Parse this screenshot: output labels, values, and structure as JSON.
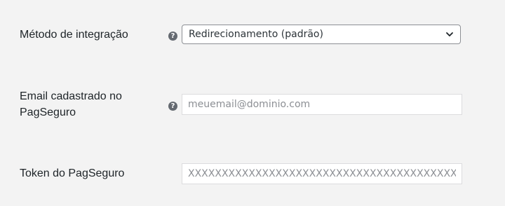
{
  "fields": {
    "integration_method": {
      "label": "Método de integração",
      "help_icon": "question-circle-icon",
      "selected": "Redirecionamento (padrão)",
      "dropdown_icon": "chevron-down-icon"
    },
    "email": {
      "label_line1": "Email cadastrado no",
      "label_line2": "PagSeguro",
      "help_icon": "question-circle-icon",
      "placeholder": "meuemail@dominio.com",
      "value": ""
    },
    "token": {
      "label": "Token do PagSeguro",
      "placeholder": "XXXXXXXXXXXXXXXXXXXXXXXXXXXXXXXXXXXXXXXX",
      "value": ""
    }
  },
  "colors": {
    "background": "#f3f3f3",
    "help_icon": "#646970",
    "select_border": "#8c8f94",
    "input_border": "#dcdcde"
  }
}
